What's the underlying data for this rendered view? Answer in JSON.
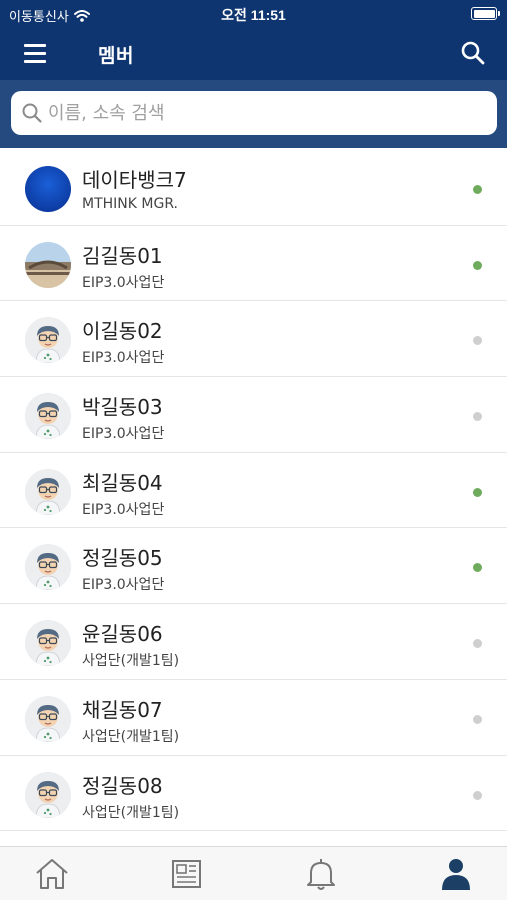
{
  "status_bar": {
    "carrier": "이동통신사",
    "time": "오전 11:51"
  },
  "header": {
    "title": "멤버",
    "menu_icon": "hamburger-menu-icon",
    "search_icon": "search-icon"
  },
  "search": {
    "placeholder": "이름, 소속 검색",
    "value": ""
  },
  "colors": {
    "header_bg": "#0e3570",
    "search_area_bg": "#244a80",
    "online": "#6fab5c",
    "offline": "#cfcfcf",
    "tab_active": "#1c3f66",
    "tab_inactive": "#777777"
  },
  "members": [
    {
      "name": "데이타뱅크7",
      "dept": "MTHINK MGR.",
      "online": true,
      "avatar": "blue-circle-avatar"
    },
    {
      "name": "김길동01",
      "dept": "EIP3.0사업단",
      "online": true,
      "avatar": "photo-avatar"
    },
    {
      "name": "이길동02",
      "dept": "EIP3.0사업단",
      "online": false,
      "avatar": "default-character-avatar"
    },
    {
      "name": "박길동03",
      "dept": "EIP3.0사업단",
      "online": false,
      "avatar": "default-character-avatar"
    },
    {
      "name": "최길동04",
      "dept": "EIP3.0사업단",
      "online": true,
      "avatar": "default-character-avatar"
    },
    {
      "name": "정길동05",
      "dept": "EIP3.0사업단",
      "online": true,
      "avatar": "default-character-avatar"
    },
    {
      "name": "윤길동06",
      "dept": "사업단(개발1팀)",
      "online": false,
      "avatar": "default-character-avatar"
    },
    {
      "name": "채길동07",
      "dept": "사업단(개발1팀)",
      "online": false,
      "avatar": "default-character-avatar"
    },
    {
      "name": "정길동08",
      "dept": "사업단(개발1팀)",
      "online": false,
      "avatar": "default-character-avatar"
    }
  ],
  "tabs": [
    {
      "icon": "home-icon",
      "active": false
    },
    {
      "icon": "news-icon",
      "active": false
    },
    {
      "icon": "bell-icon",
      "active": false
    },
    {
      "icon": "person-icon",
      "active": true
    }
  ]
}
